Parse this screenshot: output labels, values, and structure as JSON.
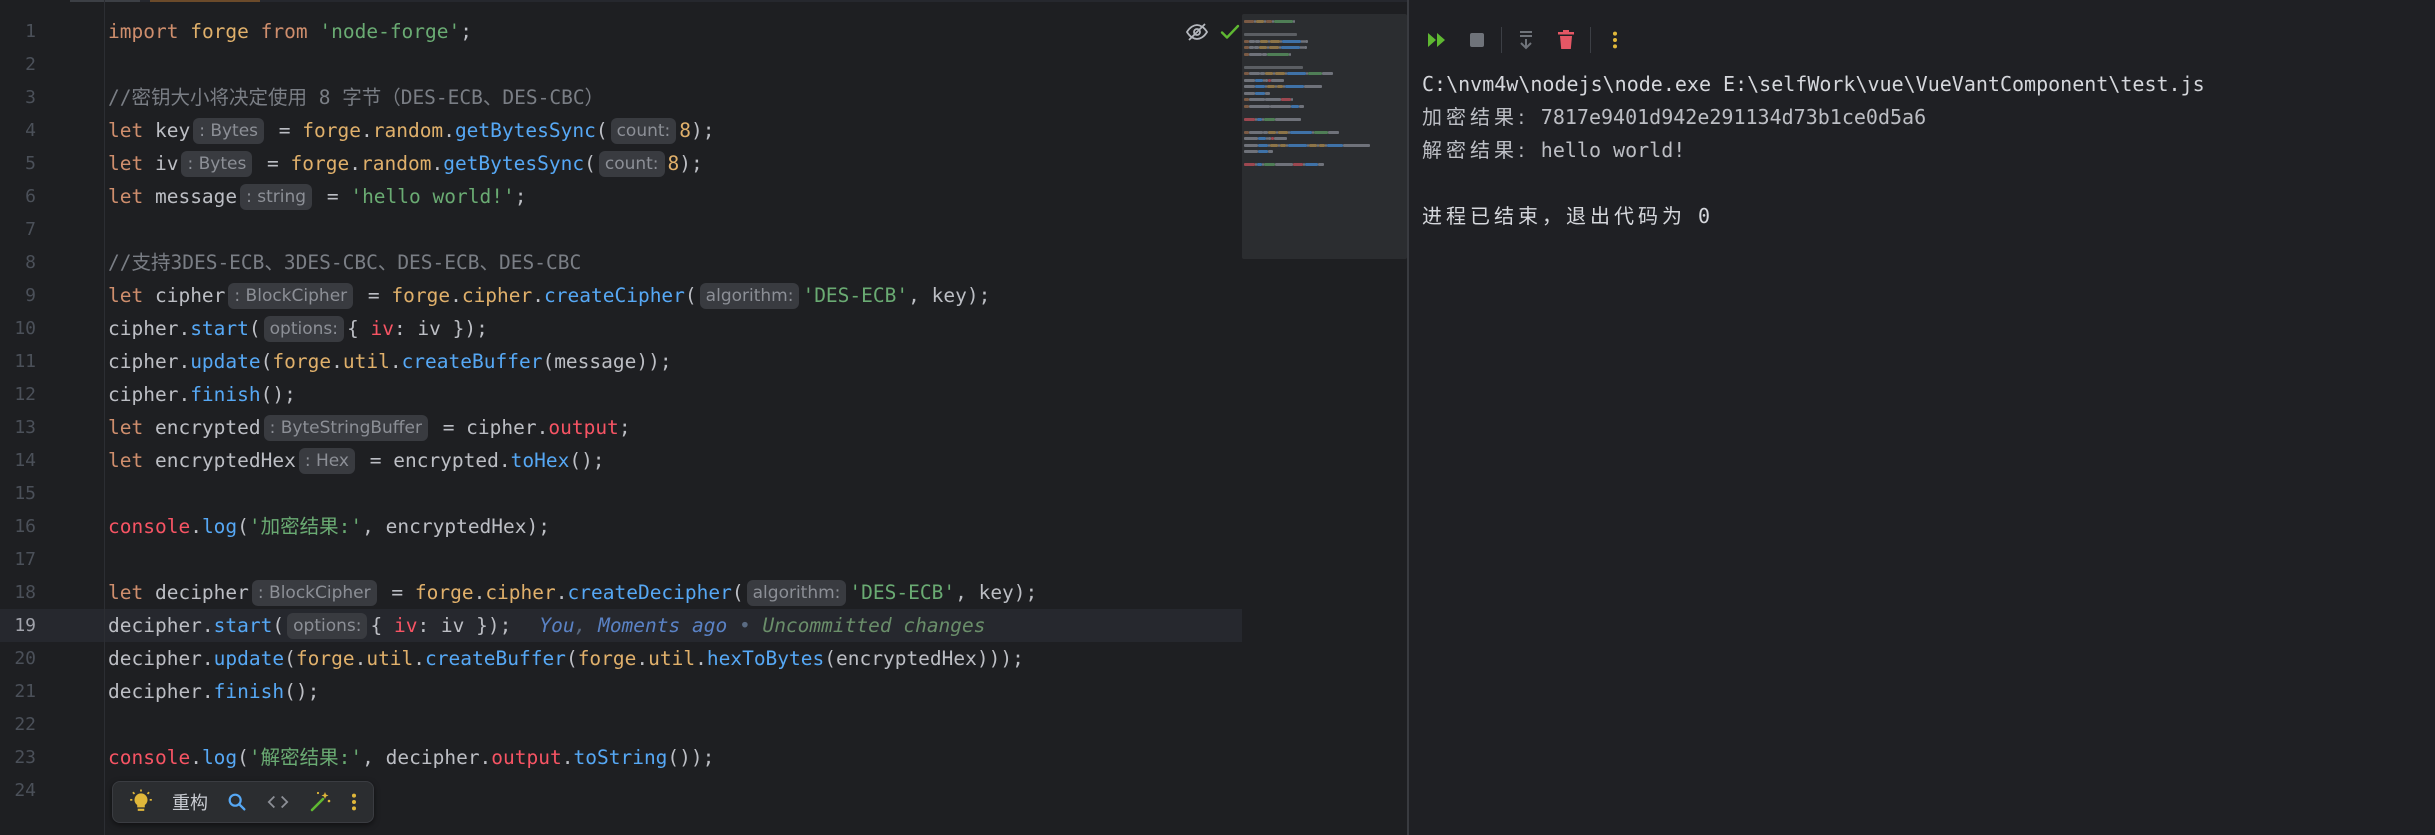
{
  "editor": {
    "lines": [
      {
        "n": "1",
        "tokens": [
          {
            "t": "import",
            "c": "kw"
          },
          {
            "t": " "
          },
          {
            "t": "forge",
            "c": "mod"
          },
          {
            "t": " "
          },
          {
            "t": "from",
            "c": "kw"
          },
          {
            "t": " "
          },
          {
            "t": "'node-forge'",
            "c": "str"
          },
          {
            "t": ";"
          }
        ]
      },
      {
        "n": "2",
        "tokens": []
      },
      {
        "n": "3",
        "tokens": [
          {
            "t": "//密钥大小将决定使用 8 字节（DES-ECB、DES-CBC）",
            "c": "cmt"
          }
        ]
      },
      {
        "n": "4",
        "tokens": [
          {
            "t": "let",
            "c": "kw"
          },
          {
            "t": " key"
          },
          {
            "h": ": Bytes"
          },
          {
            "t": " = "
          },
          {
            "t": "forge",
            "c": "mod"
          },
          {
            "t": "."
          },
          {
            "t": "random",
            "c": "mod"
          },
          {
            "t": "."
          },
          {
            "t": "getBytesSync",
            "c": "fn"
          },
          {
            "t": "("
          },
          {
            "h": "count:"
          },
          {
            "t": "8",
            "c": "num"
          },
          {
            "t": ");"
          }
        ]
      },
      {
        "n": "5",
        "tokens": [
          {
            "t": "let",
            "c": "kw"
          },
          {
            "t": " iv"
          },
          {
            "h": ": Bytes"
          },
          {
            "t": " = "
          },
          {
            "t": "forge",
            "c": "mod"
          },
          {
            "t": "."
          },
          {
            "t": "random",
            "c": "mod"
          },
          {
            "t": "."
          },
          {
            "t": "getBytesSync",
            "c": "fn"
          },
          {
            "t": "("
          },
          {
            "h": "count:"
          },
          {
            "t": "8",
            "c": "num"
          },
          {
            "t": ");"
          }
        ]
      },
      {
        "n": "6",
        "tokens": [
          {
            "t": "let",
            "c": "kw"
          },
          {
            "t": " message"
          },
          {
            "h": ": string"
          },
          {
            "t": " = "
          },
          {
            "t": "'hello world!'",
            "c": "str"
          },
          {
            "t": ";"
          }
        ]
      },
      {
        "n": "7",
        "tokens": []
      },
      {
        "n": "8",
        "tokens": [
          {
            "t": "//支持3DES-ECB、3DES-CBC、DES-ECB、DES-CBC",
            "c": "cmt"
          }
        ]
      },
      {
        "n": "9",
        "tokens": [
          {
            "t": "let",
            "c": "kw"
          },
          {
            "t": " cipher"
          },
          {
            "h": ": BlockCipher"
          },
          {
            "t": " = "
          },
          {
            "t": "forge",
            "c": "mod"
          },
          {
            "t": "."
          },
          {
            "t": "cipher",
            "c": "mod"
          },
          {
            "t": "."
          },
          {
            "t": "createCipher",
            "c": "fn"
          },
          {
            "t": "("
          },
          {
            "h": "algorithm:"
          },
          {
            "t": "'DES-ECB'",
            "c": "str"
          },
          {
            "t": ", key);"
          }
        ]
      },
      {
        "n": "10",
        "tokens": [
          {
            "t": "cipher."
          },
          {
            "t": "start",
            "c": "fn"
          },
          {
            "t": "("
          },
          {
            "h": "options:"
          },
          {
            "t": "{ "
          },
          {
            "t": "iv",
            "c": "err"
          },
          {
            "t": ": iv });"
          }
        ]
      },
      {
        "n": "11",
        "tokens": [
          {
            "t": "cipher."
          },
          {
            "t": "update",
            "c": "fn"
          },
          {
            "t": "("
          },
          {
            "t": "forge",
            "c": "mod"
          },
          {
            "t": "."
          },
          {
            "t": "util",
            "c": "mod"
          },
          {
            "t": "."
          },
          {
            "t": "createBuffer",
            "c": "fn"
          },
          {
            "t": "(message));"
          }
        ]
      },
      {
        "n": "12",
        "tokens": [
          {
            "t": "cipher."
          },
          {
            "t": "finish",
            "c": "fn"
          },
          {
            "t": "();"
          }
        ]
      },
      {
        "n": "13",
        "tokens": [
          {
            "t": "let",
            "c": "kw"
          },
          {
            "t": " encrypted"
          },
          {
            "h": ": ByteStringBuffer"
          },
          {
            "t": " = cipher."
          },
          {
            "t": "output",
            "c": "err"
          },
          {
            "t": ";"
          }
        ]
      },
      {
        "n": "14",
        "tokens": [
          {
            "t": "let",
            "c": "kw"
          },
          {
            "t": " encryptedHex"
          },
          {
            "h": ": Hex"
          },
          {
            "t": " = encrypted."
          },
          {
            "t": "toHex",
            "c": "fn"
          },
          {
            "t": "();"
          }
        ]
      },
      {
        "n": "15",
        "tokens": []
      },
      {
        "n": "16",
        "tokens": [
          {
            "t": "console",
            "c": "err"
          },
          {
            "t": "."
          },
          {
            "t": "log",
            "c": "fn"
          },
          {
            "t": "("
          },
          {
            "t": "'加密结果:'",
            "c": "str"
          },
          {
            "t": ", encryptedHex);"
          }
        ]
      },
      {
        "n": "17",
        "tokens": []
      },
      {
        "n": "18",
        "tokens": [
          {
            "t": "let",
            "c": "kw"
          },
          {
            "t": " decipher"
          },
          {
            "h": ": BlockCipher"
          },
          {
            "t": " = "
          },
          {
            "t": "forge",
            "c": "mod"
          },
          {
            "t": "."
          },
          {
            "t": "cipher",
            "c": "mod"
          },
          {
            "t": "."
          },
          {
            "t": "createDecipher",
            "c": "fn"
          },
          {
            "t": "("
          },
          {
            "h": "algorithm:"
          },
          {
            "t": "'DES-ECB'",
            "c": "str"
          },
          {
            "t": ", key);"
          }
        ]
      },
      {
        "n": "19",
        "current": true,
        "tokens": [
          {
            "t": "decipher."
          },
          {
            "t": "start",
            "c": "fn"
          },
          {
            "t": "("
          },
          {
            "h": "options:"
          },
          {
            "t": "{ "
          },
          {
            "t": "iv",
            "c": "err"
          },
          {
            "t": ": iv });"
          }
        ],
        "blame": {
          "author": "You",
          "sep1": ", ",
          "time": "Moments ago",
          "sep2": " • ",
          "status": "Uncommitted changes"
        }
      },
      {
        "n": "20",
        "tokens": [
          {
            "t": "decipher."
          },
          {
            "t": "update",
            "c": "fn"
          },
          {
            "t": "("
          },
          {
            "t": "forge",
            "c": "mod"
          },
          {
            "t": "."
          },
          {
            "t": "util",
            "c": "mod"
          },
          {
            "t": "."
          },
          {
            "t": "createBuffer",
            "c": "fn"
          },
          {
            "t": "("
          },
          {
            "t": "forge",
            "c": "mod"
          },
          {
            "t": "."
          },
          {
            "t": "util",
            "c": "mod"
          },
          {
            "t": "."
          },
          {
            "t": "hexToBytes",
            "c": "fn"
          },
          {
            "t": "(encryptedHex)));"
          }
        ]
      },
      {
        "n": "21",
        "tokens": [
          {
            "t": "decipher."
          },
          {
            "t": "finish",
            "c": "fn"
          },
          {
            "t": "();"
          }
        ]
      },
      {
        "n": "22",
        "tokens": []
      },
      {
        "n": "23",
        "tokens": [
          {
            "t": "console",
            "c": "err"
          },
          {
            "t": "."
          },
          {
            "t": "log",
            "c": "fn"
          },
          {
            "t": "("
          },
          {
            "t": "'解密结果:'",
            "c": "str"
          },
          {
            "t": ", decipher."
          },
          {
            "t": "output",
            "c": "err"
          },
          {
            "t": "."
          },
          {
            "t": "toString",
            "c": "fn"
          },
          {
            "t": "());"
          }
        ]
      },
      {
        "n": "24",
        "tokens": []
      }
    ],
    "floating_toolbar": {
      "refactor_label": "重构",
      "icons": [
        "bulb-icon",
        "search-icon",
        "code-brackets-icon",
        "magic-wand-icon",
        "more-vertical-icon"
      ]
    },
    "status_icons": [
      "eye-slash-icon",
      "check-icon"
    ]
  },
  "run_panel": {
    "toolbar": [
      "rerun-icon",
      "stop-icon",
      "scroll-to-end-icon",
      "clear-icon",
      "more-vertical-icon"
    ],
    "console": {
      "command": "C:\\nvm4w\\nodejs\\node.exe E:\\selfWork\\vue\\VueVantComponent\\test.js",
      "encrypt_label": "加密结果:",
      "encrypt_value": " 7817e9401d942e291134d73b1ce0d5a6",
      "decrypt_label": "解密结果:",
      "decrypt_value": " hello world!",
      "exit_label": "进程已结束，退出代码为",
      "exit_code": " 0"
    }
  },
  "colors": {
    "editor_bg": "#1e1f22",
    "keyword": "#cf8e6d",
    "string": "#6aab73",
    "comment": "#7a7e85",
    "function": "#56a8f5",
    "member": "#e0b06b",
    "highlight": "#f75464",
    "accent_green": "#5fb832",
    "accent_red": "#e55765",
    "accent_yellow": "#e0b73a"
  }
}
